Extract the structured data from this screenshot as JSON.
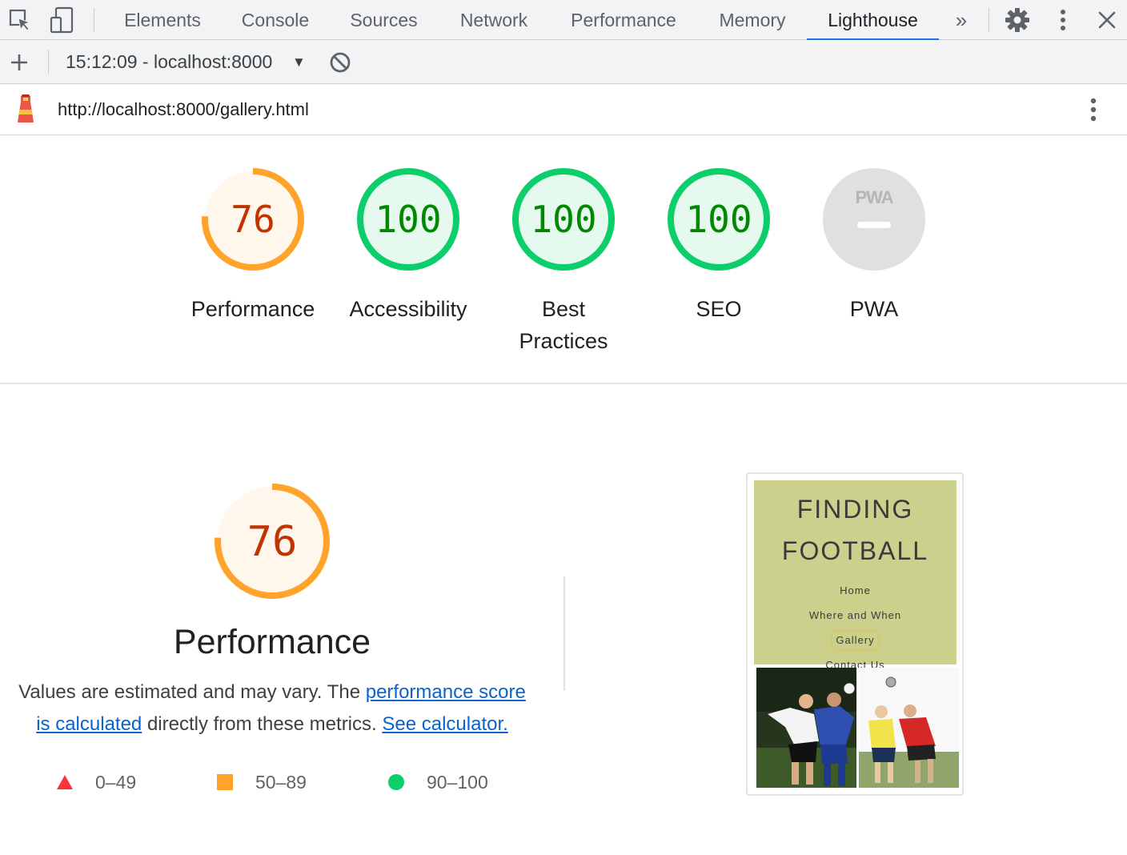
{
  "devtools": {
    "tabs": [
      "Elements",
      "Console",
      "Sources",
      "Network",
      "Performance",
      "Memory",
      "Lighthouse"
    ],
    "active_tab": "Lighthouse",
    "more_tabs_glyph": "»",
    "icons": [
      "inspect-element-icon",
      "device-toggle-icon",
      "chevrons-more-icon",
      "gear-icon",
      "kebab-menu-icon",
      "close-icon"
    ]
  },
  "lighthouse_toolbar": {
    "report_label": "15:12:09 - localhost:8000",
    "icons": [
      "plus-icon",
      "dropdown-arrow-icon",
      "clear-circle-icon"
    ]
  },
  "url_bar": {
    "url": "http://localhost:8000/gallery.html",
    "icons": [
      "lighthouse-logo-icon",
      "kebab-menu-icon"
    ]
  },
  "gauges": [
    {
      "label": "Performance",
      "score": "76",
      "value": 0.76,
      "status": "average"
    },
    {
      "label": "Accessibility",
      "score": "100",
      "value": 1.0,
      "status": "pass"
    },
    {
      "label_line1": "Best",
      "label_line2": "Practices",
      "score": "100",
      "value": 1.0,
      "status": "pass"
    },
    {
      "label": "SEO",
      "score": "100",
      "value": 1.0,
      "status": "pass"
    },
    {
      "label": "PWA",
      "badge": "PWA",
      "status": "na"
    }
  ],
  "colors": {
    "average_arc": "#ffa32b",
    "average_fill": "#fff6ec",
    "average_text": "#c33300",
    "pass_arc": "#0cce6b",
    "pass_fill": "#e6f9ef",
    "pass_text": "#008800",
    "na_fill": "#e0e0e0",
    "link": "#0b63ce",
    "accent_tab": "#1a73e8",
    "fail": "#ff3333"
  },
  "performance": {
    "score": "76",
    "value": 0.76,
    "title": "Performance",
    "desc_prefix": "Values are estimated and may vary. The ",
    "link1": "performance score is calculated",
    "desc_middle": " directly from these metrics. ",
    "link2": "See calculator.",
    "legend": [
      {
        "range": "0–49",
        "shape": "triangle",
        "color": "#ff3333"
      },
      {
        "range": "50–89",
        "shape": "square",
        "color": "#ffa32b"
      },
      {
        "range": "90–100",
        "shape": "circle",
        "color": "#0cce6b"
      }
    ]
  },
  "screenshot": {
    "title_line1": "FINDING",
    "title_line2": "FOOTBALL",
    "nav": [
      "Home",
      "Where and When",
      "Gallery",
      "Contact Us"
    ],
    "current_nav": "Gallery"
  }
}
